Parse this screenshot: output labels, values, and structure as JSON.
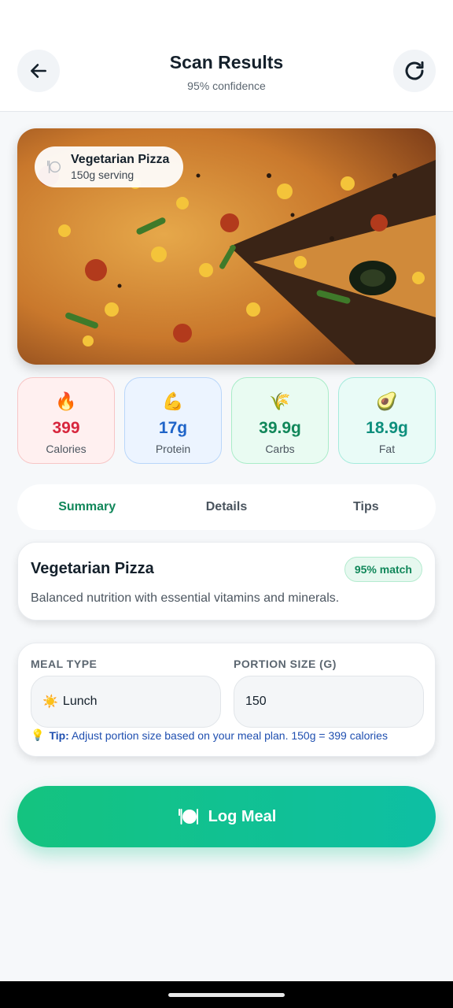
{
  "header": {
    "title": "Scan Results",
    "subtitle": "95% confidence",
    "back_icon": "arrow-left-icon",
    "refresh_icon": "refresh-icon"
  },
  "food": {
    "name": "Vegetarian Pizza",
    "serving": "150g serving",
    "chip_icon": "plate-cutlery-icon"
  },
  "macros": [
    {
      "icon": "🔥",
      "value": "399",
      "label": "Calories"
    },
    {
      "icon": "💪",
      "value": "17g",
      "label": "Protein"
    },
    {
      "icon": "🌾",
      "value": "39.9g",
      "label": "Carbs"
    },
    {
      "icon": "🥑",
      "value": "18.9g",
      "label": "Fat"
    }
  ],
  "tabs": [
    {
      "label": "Summary",
      "active": true
    },
    {
      "label": "Details",
      "active": false
    },
    {
      "label": "Tips",
      "active": false
    }
  ],
  "summary": {
    "name": "Vegetarian Pizza",
    "match": "95% match",
    "description": "Balanced nutrition with essential vitamins and minerals."
  },
  "meal": {
    "meal_type_label": "MEAL TYPE",
    "meal_type_icon": "☀️",
    "meal_type_value": "Lunch",
    "portion_label": "PORTION SIZE (G)",
    "portion_value": "150",
    "tip_icon": "💡",
    "tip_label": "Tip:",
    "tip_text": "Adjust portion size based on your meal plan. 150g = 399 calories"
  },
  "log_button": {
    "label": "Log Meal",
    "icon": "plate-cutlery-icon"
  },
  "colors": {
    "accent": "#11875a",
    "button_start": "#14c37f",
    "button_end": "#0ebfa4",
    "calories": "#d7263d",
    "protein": "#1f64c8",
    "carbs": "#11875a",
    "fat": "#0e8f7d"
  }
}
